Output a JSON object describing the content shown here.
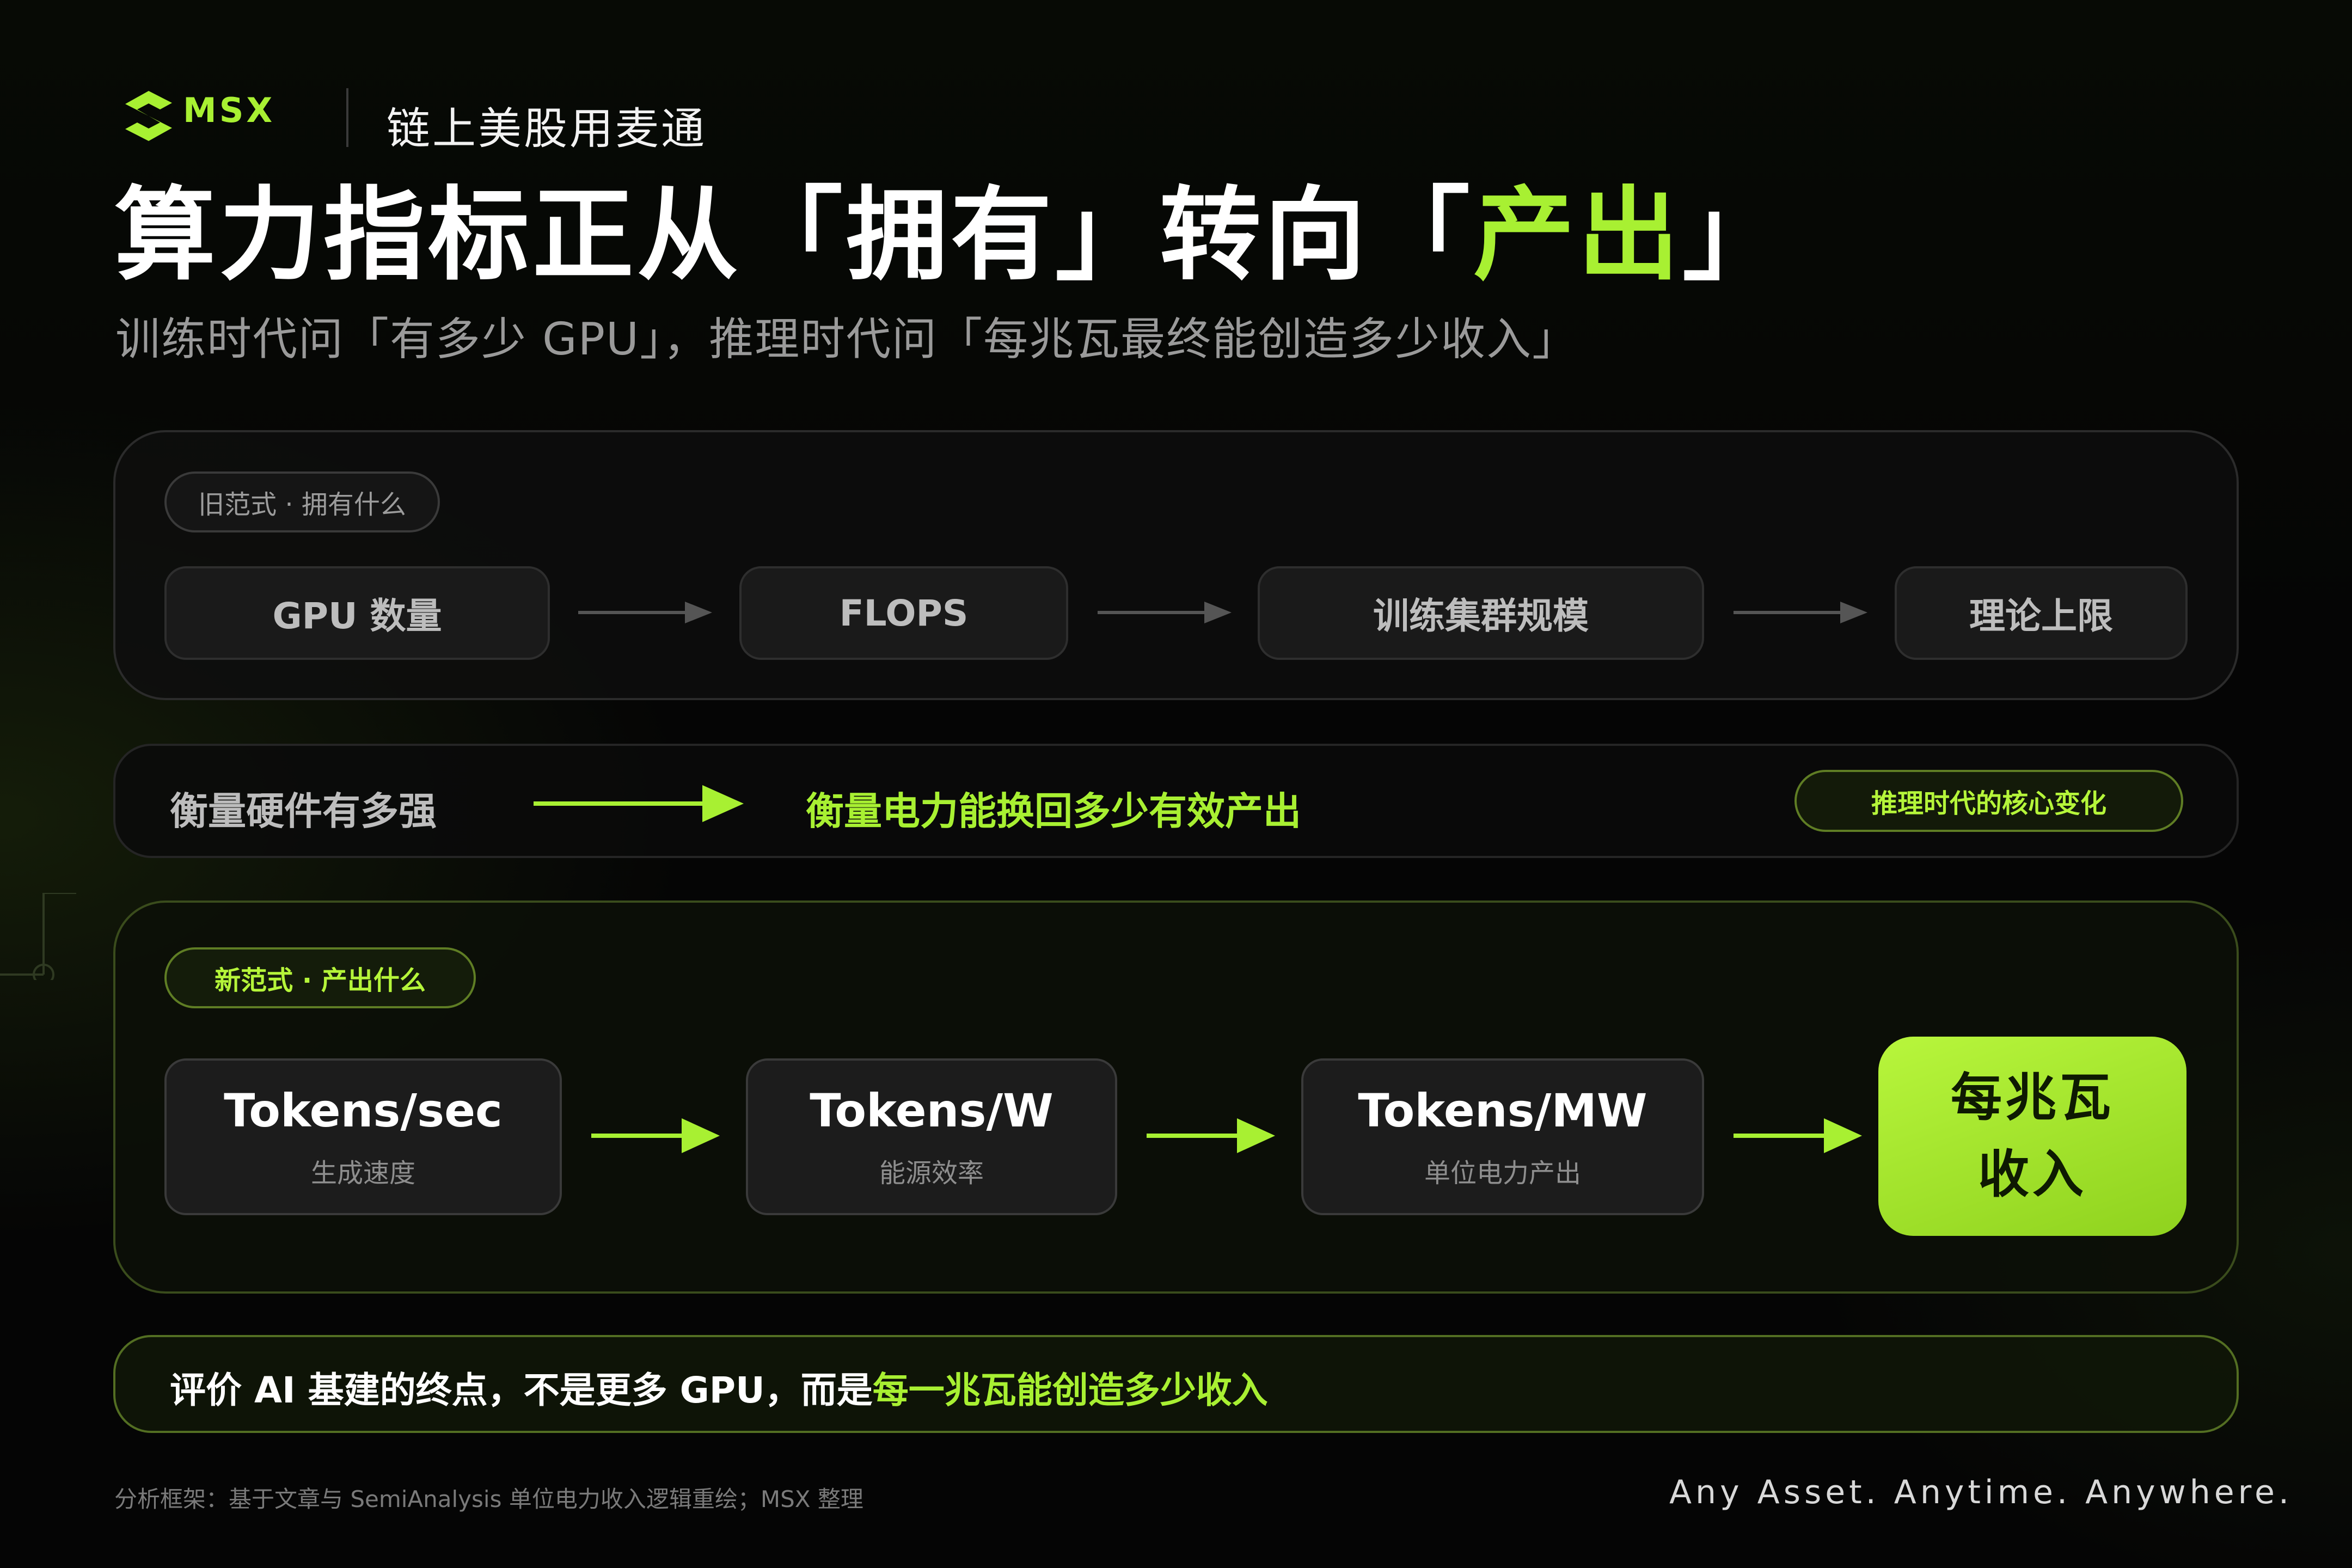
{
  "header": {
    "logo_text": "MSX",
    "tagline": "链上美股用麦通"
  },
  "title": {
    "part1": "算力指标正从「拥有」转向「",
    "highlight": "产出",
    "part2": "」"
  },
  "subtitle": "训练时代问「有多少 GPU」，推理时代问「每兆瓦最终能创造多少收入」",
  "old_paradigm": {
    "tag": "旧范式 · 拥有什么",
    "steps": [
      "GPU 数量",
      "FLOPS",
      "训练集群规模",
      "理论上限"
    ]
  },
  "shift": {
    "from": "衡量硬件有多强",
    "to": "衡量电力能换回多少有效产出",
    "tag": "推理时代的核心变化"
  },
  "new_paradigm": {
    "tag": "新范式 · 产出什么",
    "steps": [
      {
        "title": "Tokens/sec",
        "subtitle": "生成速度"
      },
      {
        "title": "Tokens/W",
        "subtitle": "能源效率"
      },
      {
        "title": "Tokens/MW",
        "subtitle": "单位电力产出"
      }
    ],
    "final_line1": "每兆瓦",
    "final_line2": "收入"
  },
  "conclusion": {
    "prefix": "评价 AI 基建的终点，不是更多 GPU，而是",
    "highlight": "每一兆瓦能创造多少收入"
  },
  "footer": {
    "source": "分析框架：基于文章与 SemiAnalysis 单位电力收入逻辑重绘；MSX 整理",
    "slogan": "Any Asset. Anytime. Anywhere."
  },
  "colors": {
    "accent": "#a8f032",
    "background": "#050505",
    "muted_text": "#9a9a9a"
  }
}
